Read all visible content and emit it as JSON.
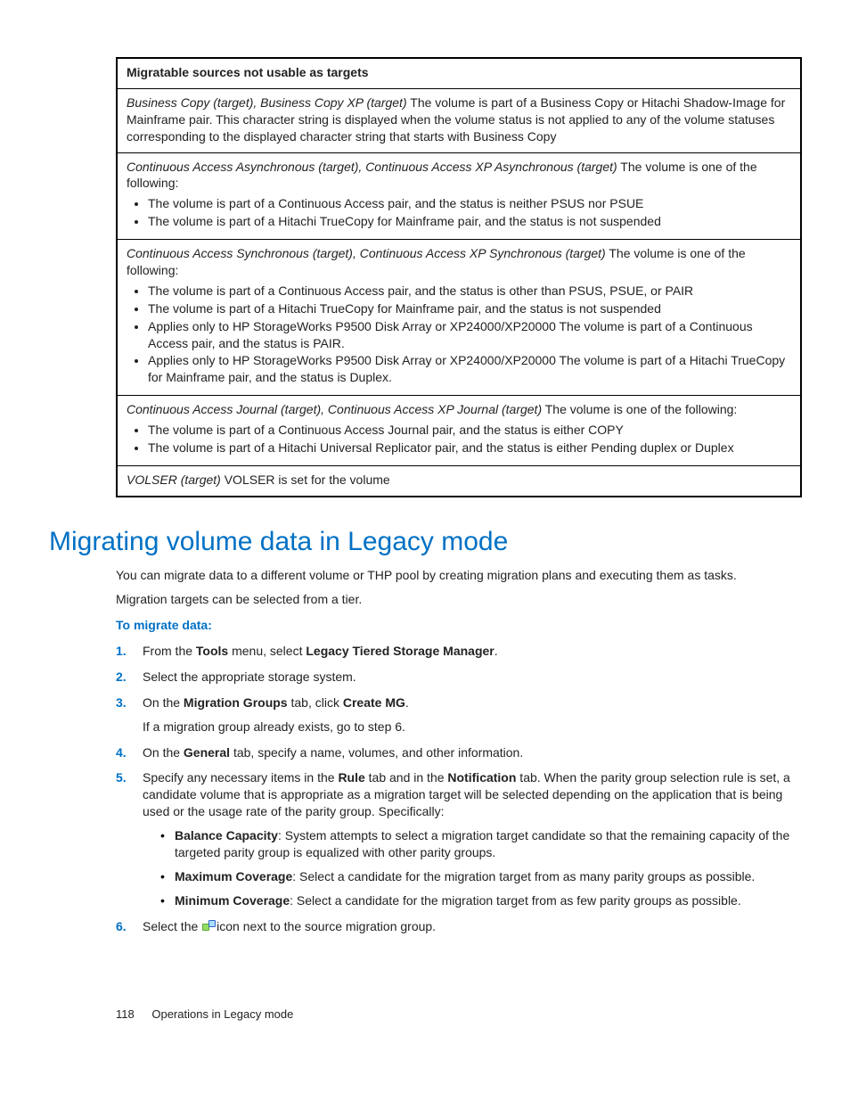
{
  "table": {
    "header": "Migratable sources not usable as targets",
    "rows": [
      {
        "prefix": "Business Copy (target), Business Copy XP (target)",
        "rest": " The volume is part of a Business Copy or Hitachi Shadow-Image for Mainframe pair. This character string is displayed when the volume status is not applied to any of the volume statuses corresponding to the displayed character string that starts with Business Copy"
      },
      {
        "prefix": "Continuous Access Asynchronous (target), Continuous Access XP Asynchronous (target)",
        "rest": " The volume is one of the following:",
        "bullets": [
          "The volume is part of a Continuous Access pair, and the status is neither PSUS nor PSUE",
          "The volume is part of a Hitachi TrueCopy for Mainframe pair, and the status is not suspended"
        ]
      },
      {
        "prefix": "Continuous Access Synchronous (target), Continuous Access XP Synchronous (target)",
        "rest": " The volume is one of the following:",
        "bullets": [
          "The volume is part of a Continuous Access pair, and the status is other than PSUS, PSUE, or PAIR",
          "The volume is part of a Hitachi TrueCopy for Mainframe pair, and the status is not suspended",
          "Applies only to HP StorageWorks P9500 Disk Array or XP24000/XP20000 The volume is part of a Continuous Access pair, and the status is PAIR.",
          "Applies only to HP StorageWorks P9500 Disk Array or XP24000/XP20000 The volume is part of a Hitachi TrueCopy for Mainframe pair, and the status is Duplex."
        ]
      },
      {
        "prefix": "Continuous Access Journal (target), Continuous Access XP Journal (target)",
        "rest": " The volume is one of the following:",
        "bullets": [
          "The volume is part of a Continuous Access Journal pair, and the status is either COPY",
          "The volume is part of a Hitachi Universal Replicator pair, and the status is either Pending duplex or Duplex"
        ]
      },
      {
        "prefix": "VOLSER (target)",
        "rest": " VOLSER is set for the volume"
      }
    ]
  },
  "heading": "Migrating volume data in Legacy mode",
  "intro1": "You can migrate data to a different volume or THP pool by creating migration plans and executing them as tasks.",
  "intro2": "Migration targets can be selected from a tier.",
  "subhead": "To migrate data:",
  "steps": {
    "s1": {
      "num": "1.",
      "a": "From the ",
      "b": "Tools",
      "c": " menu, select ",
      "d": "Legacy Tiered Storage Manager",
      "e": "."
    },
    "s2": {
      "num": "2.",
      "text": "Select the appropriate storage system."
    },
    "s3": {
      "num": "3.",
      "a": "On the ",
      "b": "Migration Groups",
      "c": " tab, click ",
      "d": "Create MG",
      "e": ".",
      "note": "If a migration group already exists, go to step 6."
    },
    "s4": {
      "num": "4.",
      "a": "On the ",
      "b": "General",
      "c": " tab, specify a name, volumes, and other information."
    },
    "s5": {
      "num": "5.",
      "a": "Specify any necessary items in the ",
      "b": "Rule",
      "c": " tab and in the ",
      "d": "Notification",
      "e": " tab. When the parity group selection rule is set, a candidate volume that is appropriate as a migration target will be selected depending on the application that is being used or the usage rate of the parity group. Specifically:",
      "bullets": [
        {
          "b": "Balance Capacity",
          "t": ": System attempts to select a migration target candidate so that the remaining capacity of the targeted parity group is equalized with other parity groups."
        },
        {
          "b": "Maximum Coverage",
          "t": ": Select a candidate for the migration target from as many parity groups as possible."
        },
        {
          "b": "Minimum Coverage",
          "t": ": Select a candidate for the migration target from as few parity groups as possible."
        }
      ]
    },
    "s6": {
      "num": "6.",
      "a": "Select the ",
      "b": "icon next to the source migration group."
    }
  },
  "footer": {
    "page": "118",
    "section": "Operations in Legacy mode"
  }
}
